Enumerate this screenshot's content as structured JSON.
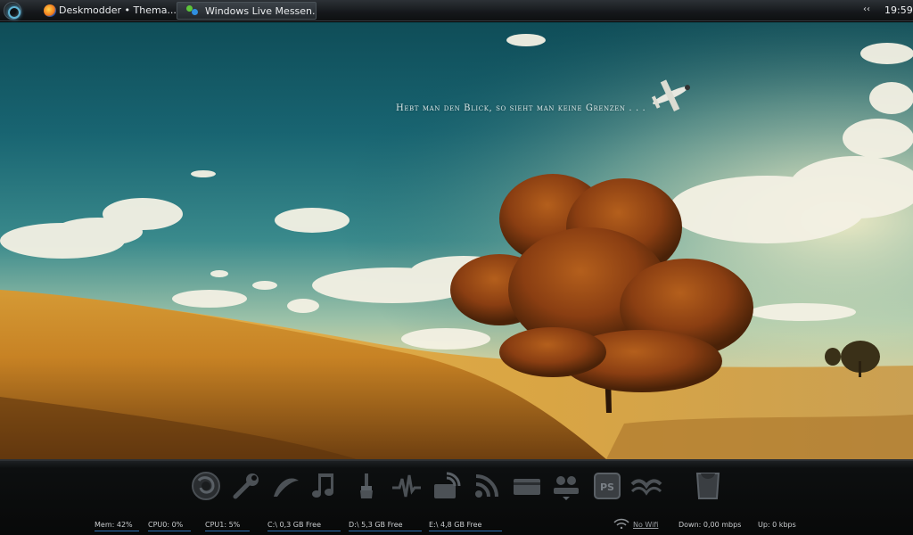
{
  "taskbar": {
    "tasks": [
      {
        "label": "Deskmodder • Thema...",
        "icon": "firefox-icon"
      },
      {
        "label": "Windows Live Messen...",
        "icon": "messenger-icon"
      }
    ],
    "tray_arrows": "‹‹",
    "clock": "19:59"
  },
  "wallpaper": {
    "quote": "Hebt man den Blick, so sieht man keine Grenzen . . ."
  },
  "dock": {
    "icons": [
      "firefox-icon",
      "wrench-icon",
      "brush-stroke-icon",
      "music-note-icon",
      "paintbrush-icon",
      "waveform-icon",
      "satellite-dish-icon",
      "rss-icon",
      "wallet-icon",
      "people-icon",
      "photoshop-icon",
      "book-icon",
      "trash-icon"
    ],
    "photoshop_label": "PS",
    "stats": {
      "mem": "Mem: 42%",
      "cpu0": "CPU0: 0%",
      "cpu1": "CPU1: 5%",
      "drive_c": "C:\\ 0,3 GB Free",
      "drive_d": "D:\\ 5,3 GB Free",
      "drive_e": "E:\\ 4,8 GB Free",
      "wifi": "No Wifi",
      "down": "Down: 0,00 mbps",
      "up": "Up: 0 kbps"
    }
  }
}
